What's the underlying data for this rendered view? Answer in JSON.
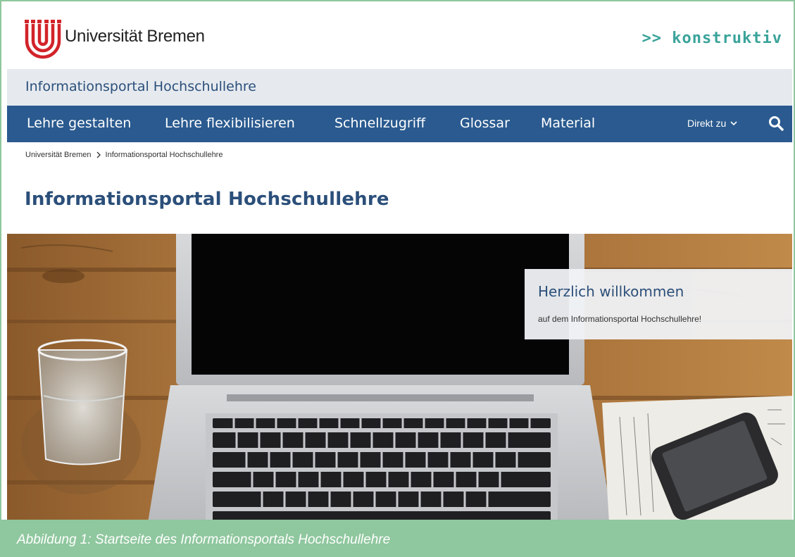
{
  "header": {
    "logo_text": "Universität Bremen",
    "slogan": ">> konstruktiv"
  },
  "portal_strip": {
    "title": "Informationsportal Hochschullehre"
  },
  "nav": {
    "items": [
      {
        "label": "Lehre gestalten"
      },
      {
        "label": "Lehre flexibilisieren"
      },
      {
        "label": "Schnellzugriff"
      },
      {
        "label": "Glossar"
      },
      {
        "label": "Material"
      }
    ],
    "direct_label": "Direkt zu",
    "icons": {
      "chevron": "chevron-down-icon",
      "search": "search-icon"
    }
  },
  "breadcrumb": {
    "items": [
      "Universität Bremen",
      "Informationsportal Hochschullehre"
    ]
  },
  "page_title": "Informationsportal Hochschullehre",
  "welcome": {
    "title": "Herzlich willkommen",
    "subtitle": "auf dem Informationsportal Hochschullehre!"
  },
  "caption": "Abbildung 1: Startseite des Informationsportals Hochschullehre",
  "colors": {
    "nav_bg": "#2a5a8f",
    "title_blue": "#2b4f7a",
    "strip_bg": "#e6eaef",
    "slogan_teal": "#3aa39a",
    "logo_red": "#d2232a",
    "caption_green": "#8fc79e"
  }
}
